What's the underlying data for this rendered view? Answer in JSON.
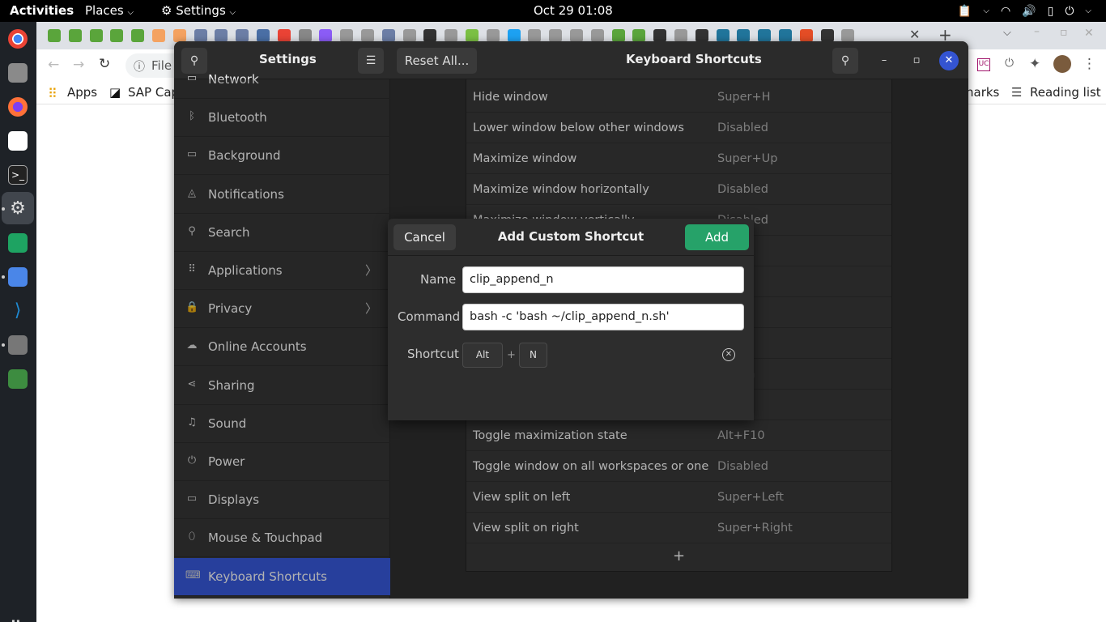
{
  "topbar": {
    "activities": "Activities",
    "places": "Places",
    "app_menu": "Settings",
    "clock": "Oct 29  01:08"
  },
  "browser": {
    "toolbar": {
      "omnibox_text": "File"
    },
    "bookmarks": {
      "apps": "Apps",
      "sap": "SAP Cap",
      "other": "harks",
      "reading_list": "Reading list"
    },
    "favicon_colors": [
      "#5aa53b",
      "#5aa53b",
      "#5aa53b",
      "#5aa53b",
      "#5aa53b",
      "#f4a261",
      "#f4a261",
      "#6c7ea6",
      "#6c7ea6",
      "#6c7ea6",
      "#4a6fa5",
      "#ea4335",
      "#888",
      "#8b5cf6",
      "#999",
      "#999",
      "#6c7ea6",
      "#999",
      "#333",
      "#999",
      "#7bc043",
      "#999",
      "#1da1f2",
      "#999",
      "#999",
      "#999",
      "#999",
      "#5aa53b",
      "#5aa53b",
      "#333",
      "#999",
      "#333",
      "#21759b",
      "#21759b",
      "#21759b",
      "#21759b",
      "#e44d26",
      "#333",
      "#999"
    ]
  },
  "settings": {
    "panel_title": "Settings",
    "reset_label": "Reset All...",
    "page_title": "Keyboard Shortcuts",
    "sidebar": [
      {
        "label": "Network",
        "icon": "network-icon",
        "glyph": "▭"
      },
      {
        "label": "Bluetooth",
        "icon": "bluetooth-icon",
        "glyph": "ᛒ"
      },
      {
        "label": "Background",
        "icon": "background-icon",
        "glyph": "▭"
      },
      {
        "label": "Notifications",
        "icon": "bell-icon",
        "glyph": "◬"
      },
      {
        "label": "Search",
        "icon": "search-icon",
        "glyph": "⚲"
      },
      {
        "label": "Applications",
        "icon": "applications-icon",
        "glyph": "⠿",
        "chevron": "〉"
      },
      {
        "label": "Privacy",
        "icon": "lock-icon",
        "glyph": "🔒",
        "chevron": "〉"
      },
      {
        "label": "Online Accounts",
        "icon": "cloud-icon",
        "glyph": "☁"
      },
      {
        "label": "Sharing",
        "icon": "share-icon",
        "glyph": "⋖"
      },
      {
        "label": "Sound",
        "icon": "music-icon",
        "glyph": "♫"
      },
      {
        "label": "Power",
        "icon": "power-icon",
        "glyph": "⏻"
      },
      {
        "label": "Displays",
        "icon": "display-icon",
        "glyph": "▭"
      },
      {
        "label": "Mouse & Touchpad",
        "icon": "mouse-icon",
        "glyph": "⬯"
      },
      {
        "label": "Keyboard Shortcuts",
        "icon": "keyboard-icon",
        "glyph": "⌨",
        "active": true
      }
    ],
    "shortcuts": [
      {
        "name": "Hide window",
        "keys": "Super+H"
      },
      {
        "name": "Lower window below other windows",
        "keys": "Disabled"
      },
      {
        "name": "Maximize window",
        "keys": "Super+Up"
      },
      {
        "name": "Maximize window horizontally",
        "keys": "Disabled"
      },
      {
        "name": "Maximize window vertically",
        "keys": "Disabled"
      },
      {
        "name": "",
        "keys": ""
      },
      {
        "name": "",
        "keys": "ed"
      },
      {
        "name": "",
        "keys": "ed"
      },
      {
        "name": "",
        "keys": ""
      },
      {
        "name": "",
        "keys": "-Down"
      },
      {
        "name": "",
        "keys": "ed"
      },
      {
        "name": "Toggle maximization state",
        "keys": "Alt+F10"
      },
      {
        "name": "Toggle window on all workspaces or one",
        "keys": "Disabled"
      },
      {
        "name": "View split on left",
        "keys": "Super+Left"
      },
      {
        "name": "View split on right",
        "keys": "Super+Right"
      }
    ],
    "add_glyph": "+"
  },
  "dialog": {
    "title": "Add Custom Shortcut",
    "cancel_label": "Cancel",
    "add_label": "Add",
    "name_label": "Name",
    "name_value": "clip_append_n",
    "command_label": "Command",
    "command_value": "bash -c 'bash ~/clip_append_n.sh'",
    "shortcut_label": "Shortcut",
    "key1": "Alt",
    "plus": "+",
    "key2": "N"
  },
  "colors": {
    "accent": "#3454d1",
    "add_button": "#26a269"
  }
}
